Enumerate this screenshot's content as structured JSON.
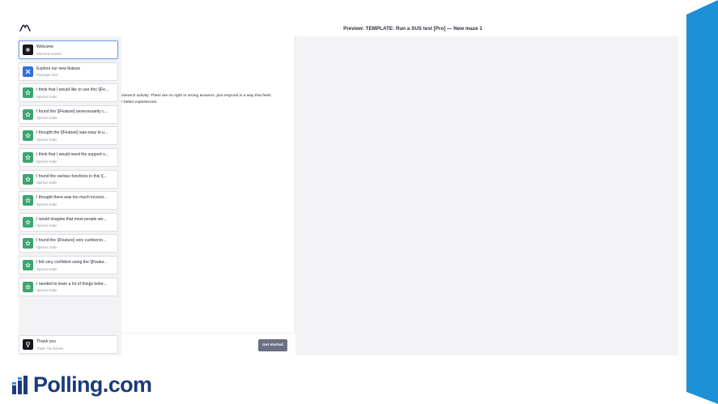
{
  "header": {
    "title": "Preview: TEMPLATE: Run a SUS test [Pro] — New maze 1"
  },
  "blocks": [
    {
      "title": "Welcome",
      "subtitle": "Welcome Screen",
      "icon": "gear-icon",
      "icon_color": "#16171c",
      "active": true
    },
    {
      "title": "Explore our new feature",
      "subtitle": "Prototype Test",
      "icon": "cross-icon",
      "icon_color": "#2f6ee4"
    },
    {
      "title": "I think that I would like to use this \\[Fe...",
      "subtitle": "Opinion Scale",
      "icon": "star-icon",
      "icon_color": "#3aa66e"
    },
    {
      "title": "I found the \\[Feature] unnecessarily c...",
      "subtitle": "Opinion Scale",
      "icon": "star-icon",
      "icon_color": "#3aa66e"
    },
    {
      "title": "I thought the \\[Feature] was easy to u...",
      "subtitle": "Opinion Scale",
      "icon": "star-icon",
      "icon_color": "#3aa66e"
    },
    {
      "title": "I think that I would need the support o...",
      "subtitle": "Opinion Scale",
      "icon": "star-icon",
      "icon_color": "#3aa66e"
    },
    {
      "title": "I found the various functions in this \\[...",
      "subtitle": "Opinion Scale",
      "icon": "star-icon",
      "icon_color": "#3aa66e"
    },
    {
      "title": "I thought there was too much inconsi...",
      "subtitle": "Opinion Scale",
      "icon": "star-icon",
      "icon_color": "#3aa66e"
    },
    {
      "title": "I would imagine that most people wo...",
      "subtitle": "Opinion Scale",
      "icon": "star-icon",
      "icon_color": "#3aa66e"
    },
    {
      "title": "I found the \\[Feature] very cumberso...",
      "subtitle": "Opinion Scale",
      "icon": "star-icon",
      "icon_color": "#3aa66e"
    },
    {
      "title": "I felt very confident using the \\[Featur...",
      "subtitle": "Opinion Scale",
      "icon": "star-icon",
      "icon_color": "#3aa66e"
    },
    {
      "title": "I needed to learn a lot of things befor...",
      "subtitle": "Opinion Scale",
      "icon": "star-icon",
      "icon_color": "#3aa66e"
    }
  ],
  "end_block": {
    "title": "Thank you",
    "subtitle": "Thank You Screen",
    "icon": "trophy-icon",
    "icon_color": "#16171c"
  },
  "preview": {
    "line1": "esearch activity. There are no right or wrong answers, just respond in a way that feels",
    "line2": "r better experiences.",
    "start_label": "Get started"
  },
  "brand": {
    "name": "Polling.com",
    "color": "#1c3b7a"
  },
  "colors": {
    "accent": "#1e90d8",
    "active_border": "#7ea2e6"
  }
}
